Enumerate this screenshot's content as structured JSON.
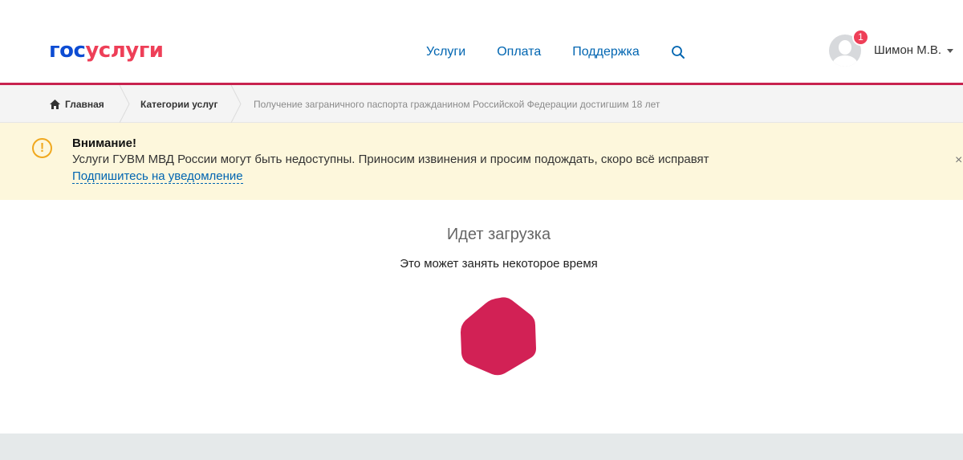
{
  "header": {
    "logo_part1": "гос",
    "logo_part2": "услуги",
    "nav": [
      "Услуги",
      "Оплата",
      "Поддержка"
    ],
    "search_icon": "search-icon",
    "user": {
      "name": "Шимон М.В.",
      "notifications": "1"
    }
  },
  "colors": {
    "brand_blue": "#0d4cd3",
    "brand_red": "#ee3f58",
    "accent_line": "#c8224e",
    "link": "#0065b1",
    "warning": "#f0a81e",
    "alert_bg": "#fdf7dc",
    "loader": "#d22155"
  },
  "breadcrumbs": [
    "Главная",
    "Категории услуг",
    "Получение заграничного паспорта гражданином Российской Федерации достигшим 18 лет"
  ],
  "alert": {
    "title": "Внимание!",
    "text": "Услуги ГУВМ МВД России могут быть недоступны. Приносим извинения и просим подождать, скоро всё исправят",
    "link": "Подпишитесь на уведомление",
    "icon": "exclamation-circle-icon",
    "close": "×"
  },
  "loading": {
    "title": "Идет загрузка",
    "subtitle": "Это может занять некоторое время"
  }
}
